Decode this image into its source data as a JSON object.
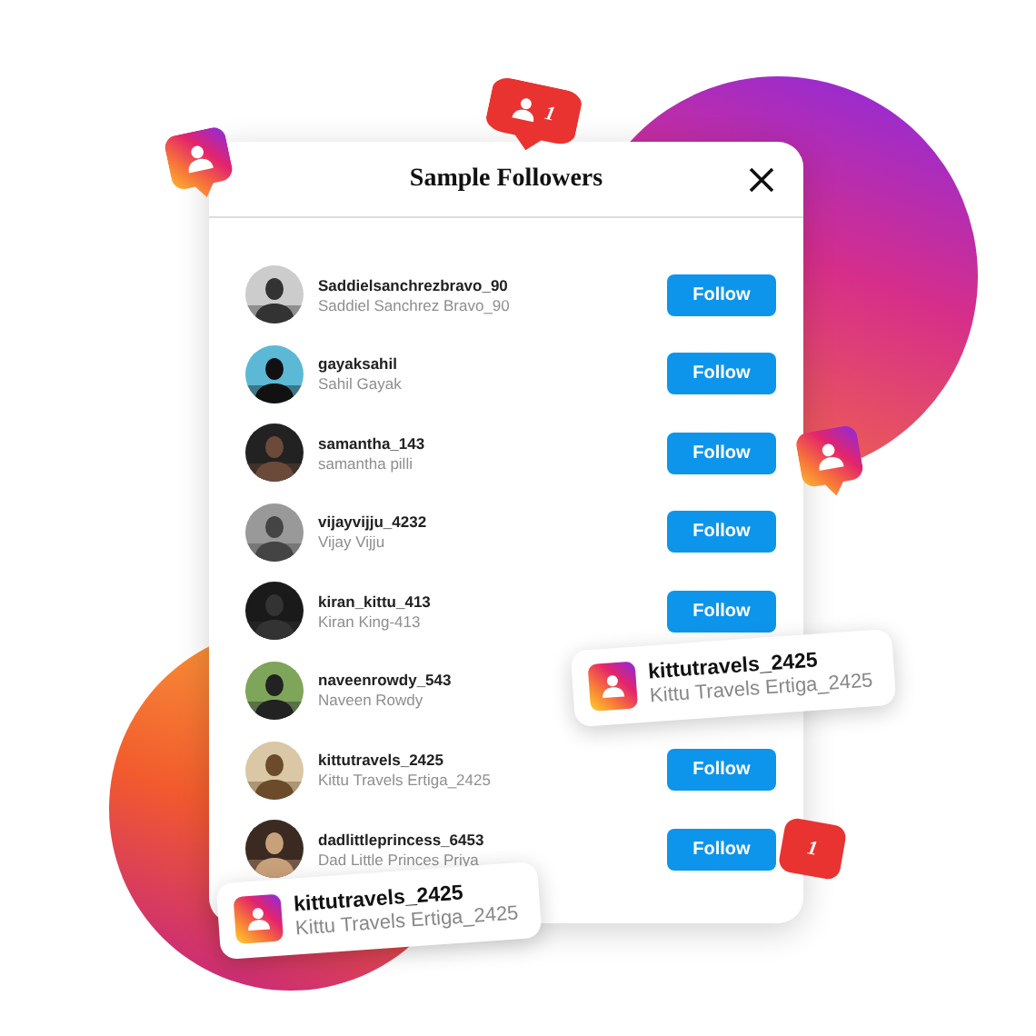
{
  "dialog": {
    "title": "Sample Followers"
  },
  "rows": [
    {
      "username": "Saddielsanchrezbravo_90",
      "name": "Saddiel Sanchrez Bravo_90",
      "button": "Follow"
    },
    {
      "username": "gayaksahil",
      "name": "Sahil Gayak",
      "button": "Follow"
    },
    {
      "username": "samantha_143",
      "name": "samantha pilli",
      "button": "Follow"
    },
    {
      "username": "vijayvijju_4232",
      "name": "Vijay Vijju",
      "button": "Follow"
    },
    {
      "username": "kiran_kittu_413",
      "name": "Kiran King-413",
      "button": "Follow"
    },
    {
      "username": "naveenrowdy_543",
      "name": "Naveen Rowdy"
    },
    {
      "username": "kittutravels_2425",
      "name": "Kittu Travels Ertiga_2425",
      "button": "Follow"
    },
    {
      "username": "dadlittleprincess_6453",
      "name": "Dad Little Princes Priya",
      "button": "Follow"
    }
  ],
  "badges": [
    {
      "kind": "profile"
    },
    {
      "kind": "alert",
      "count": "1"
    },
    {
      "kind": "profile"
    },
    {
      "kind": "count",
      "count": "1"
    }
  ],
  "cards": [
    {
      "username": "kittutravels_2425",
      "name": "Kittu Travels Ertiga_2425"
    },
    {
      "username": "kittutravels_2425",
      "name": "Kittu Travels Ertiga_2425"
    }
  ]
}
